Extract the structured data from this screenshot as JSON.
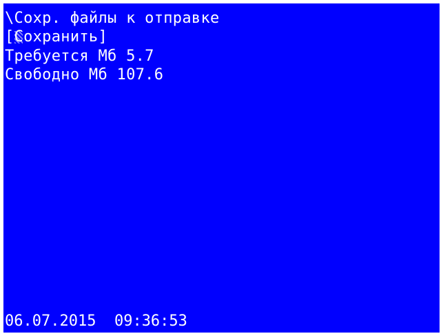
{
  "screen": {
    "title": "\\Сохр. файлы к отправке",
    "save_button": {
      "open_bracket": "[",
      "cursor_char": "С",
      "label_rest": "охранить",
      "close_bracket": "]"
    },
    "required_label": "Требуется Мб 5.7",
    "free_label": "Свободно Мб 107.6",
    "status": {
      "date": "06.07.2015",
      "time": "09:36:53"
    }
  },
  "colors": {
    "background": "#0000ff",
    "text": "#ffffff"
  }
}
